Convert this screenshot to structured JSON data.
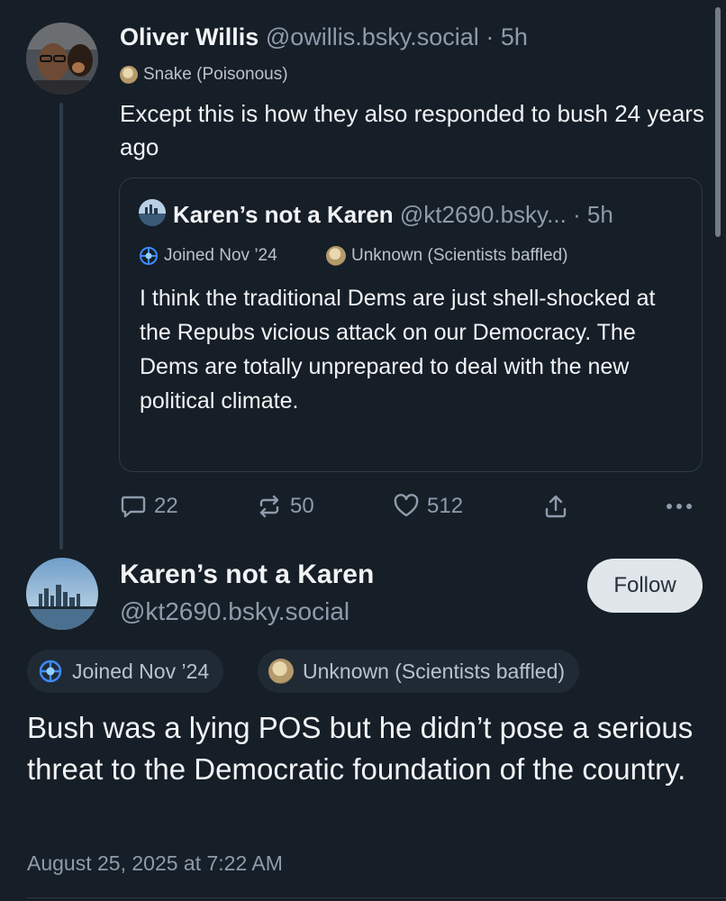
{
  "parent_post": {
    "author_name": "Oliver Willis",
    "author_handle": "@owillis.bsky.social",
    "time": "· 5h",
    "badge": "Snake (Poisonous)",
    "text": "Except this is how they also responded to bush 24 years ago",
    "quote": {
      "author_name": "Karen’s not a Karen",
      "author_handle": "@kt2690.bsky...",
      "time": "· 5h",
      "badges": [
        "Joined Nov ’24",
        "Unknown (Scientists baffled)"
      ],
      "text": "I think the traditional Dems are just shell-shocked at the Repubs vicious attack on our Democracy. The Dems are totally unprepared to deal with the new political climate."
    },
    "actions": {
      "reply_count": "22",
      "repost_count": "50",
      "like_count": "512"
    }
  },
  "main_post": {
    "author_name": "Karen’s not a Karen",
    "author_handle": "@kt2690.bsky.social",
    "follow_label": "Follow",
    "badges": [
      "Joined Nov ’24",
      "Unknown (Scientists baffled)"
    ],
    "text": "Bush was a lying POS but he didn’t pose a serious threat to the Democratic foundation of the country.",
    "timestamp": "August 25, 2025 at 7:22 AM"
  },
  "colors": {
    "background": "#161e27",
    "text": "#f1f3f5",
    "muted": "#8e9bab",
    "border": "#2e3a48",
    "follow_bg": "#e1e6eb"
  },
  "icons": {
    "reply": "speech-bubble-icon",
    "repost": "repost-arrows-icon",
    "like": "heart-icon",
    "share": "share-upload-icon",
    "more": "ellipsis-icon",
    "joined": "globe-badge-icon",
    "snake": "snake-badge-icon"
  }
}
